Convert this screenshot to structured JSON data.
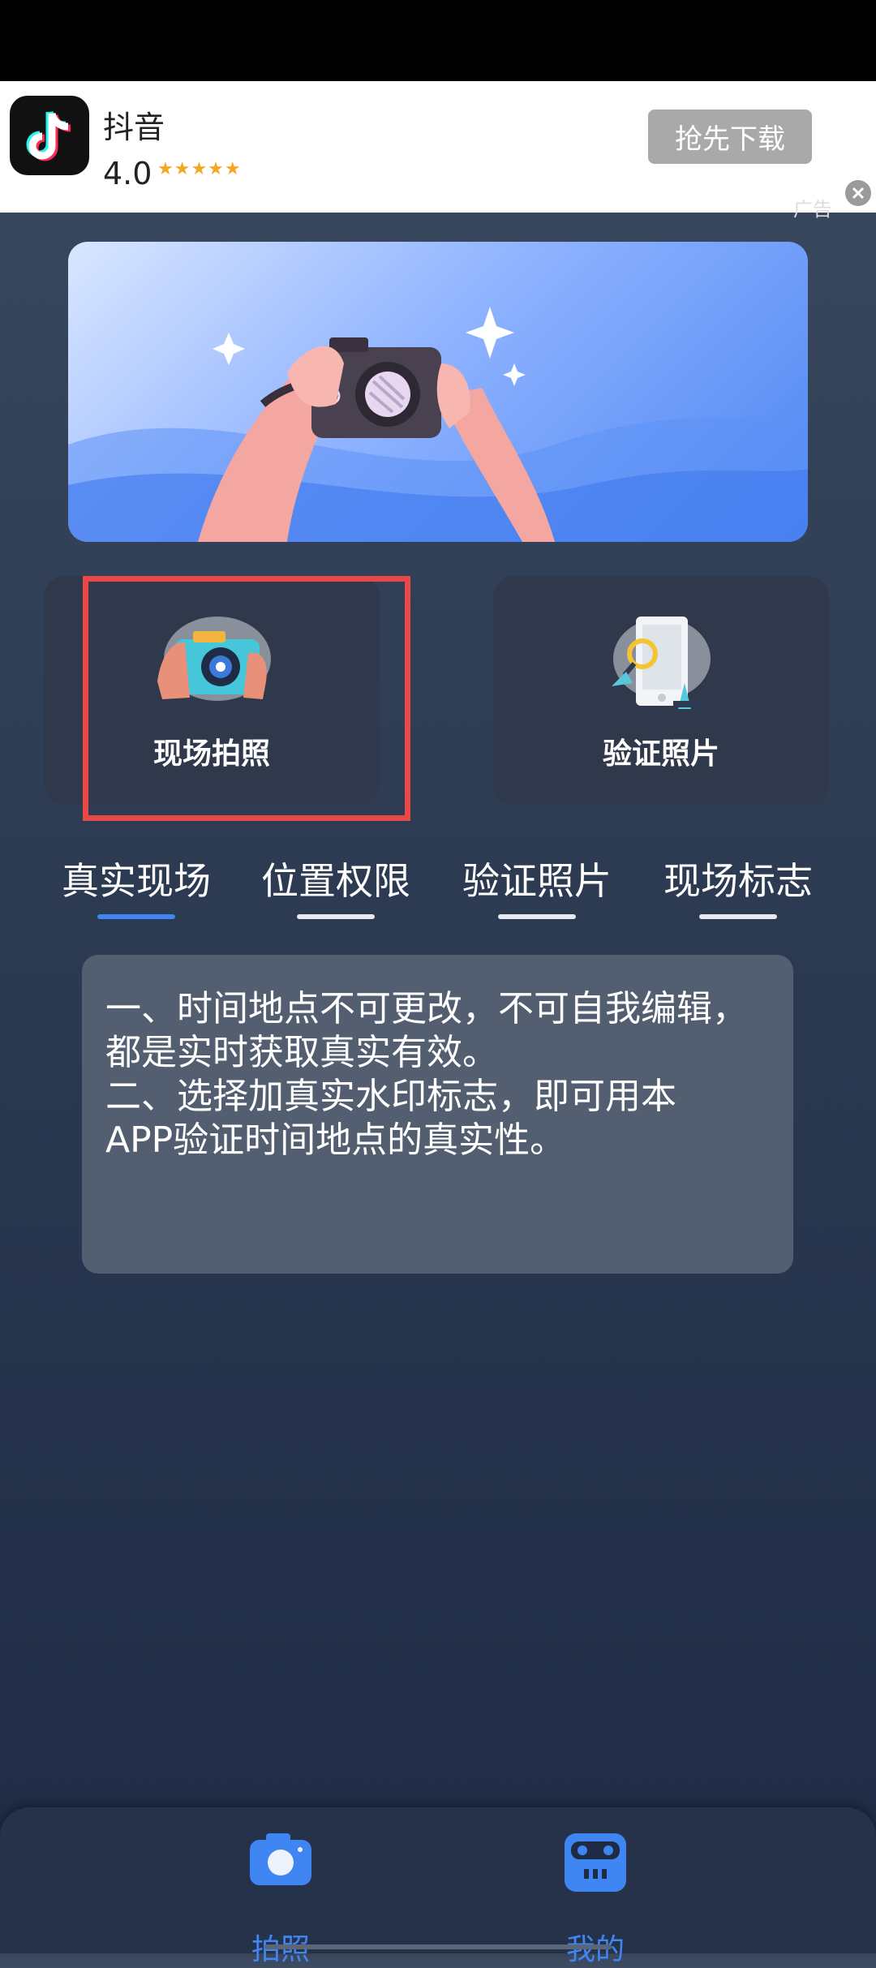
{
  "ad": {
    "app_name": "抖音",
    "rating": "4.0",
    "stars": "★★★★★",
    "download_label": "抢先下载",
    "tag": "广告"
  },
  "cards": {
    "capture_label": "现场拍照",
    "verify_label": "验证照片"
  },
  "tabs": [
    {
      "label": "真实现场",
      "active": true
    },
    {
      "label": "位置权限",
      "active": false
    },
    {
      "label": "验证照片",
      "active": false
    },
    {
      "label": "现场标志",
      "active": false
    }
  ],
  "info": {
    "lines": [
      "一、时间地点不可更改，不可自我编辑，",
      "都是实时获取真实有效。",
      "二、选择加真实水印标志，即可用本",
      "APP验证时间地点的真实性。"
    ]
  },
  "bottom_nav": {
    "items": [
      {
        "label": "拍照",
        "icon": "camera-icon"
      },
      {
        "label": "我的",
        "icon": "robot-face-icon"
      }
    ]
  },
  "colors": {
    "accent": "#3f86f3",
    "highlight": "#e84848",
    "card_bg": "#2f394b",
    "info_bg": "#535f70"
  }
}
